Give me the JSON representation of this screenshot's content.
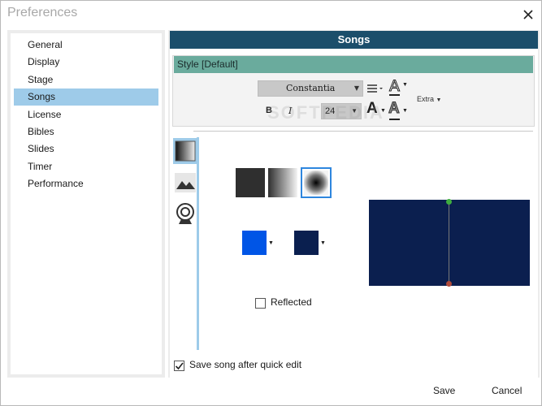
{
  "window": {
    "title": "Preferences",
    "close_icon": "close-icon"
  },
  "sidebar": {
    "items": [
      {
        "label": "General"
      },
      {
        "label": "Display"
      },
      {
        "label": "Stage"
      },
      {
        "label": "Songs",
        "selected": true
      },
      {
        "label": "License"
      },
      {
        "label": "Bibles"
      },
      {
        "label": "Slides"
      },
      {
        "label": "Timer"
      },
      {
        "label": "Performance"
      }
    ]
  },
  "main": {
    "header": "Songs",
    "style_label": "Style [Default]",
    "toolbar": {
      "font": "Constantia",
      "size": "24",
      "bold": "B",
      "italic": "I",
      "extra": "Extra",
      "letter_a": "A"
    },
    "background": {
      "tabs": [
        "gradient-icon",
        "image-icon",
        "webcam-icon"
      ],
      "color_1": "#0055e6",
      "color_2": "#0a1f4f",
      "preview_color": "#0b1f4f",
      "reflected_label": "Reflected",
      "reflected_checked": false
    },
    "save_after_edit_label": "Save song after quick edit",
    "save_after_edit_checked": true
  },
  "footer": {
    "save_label": "Save",
    "cancel_label": "Cancel"
  },
  "watermark": "SOFTPEDIA"
}
